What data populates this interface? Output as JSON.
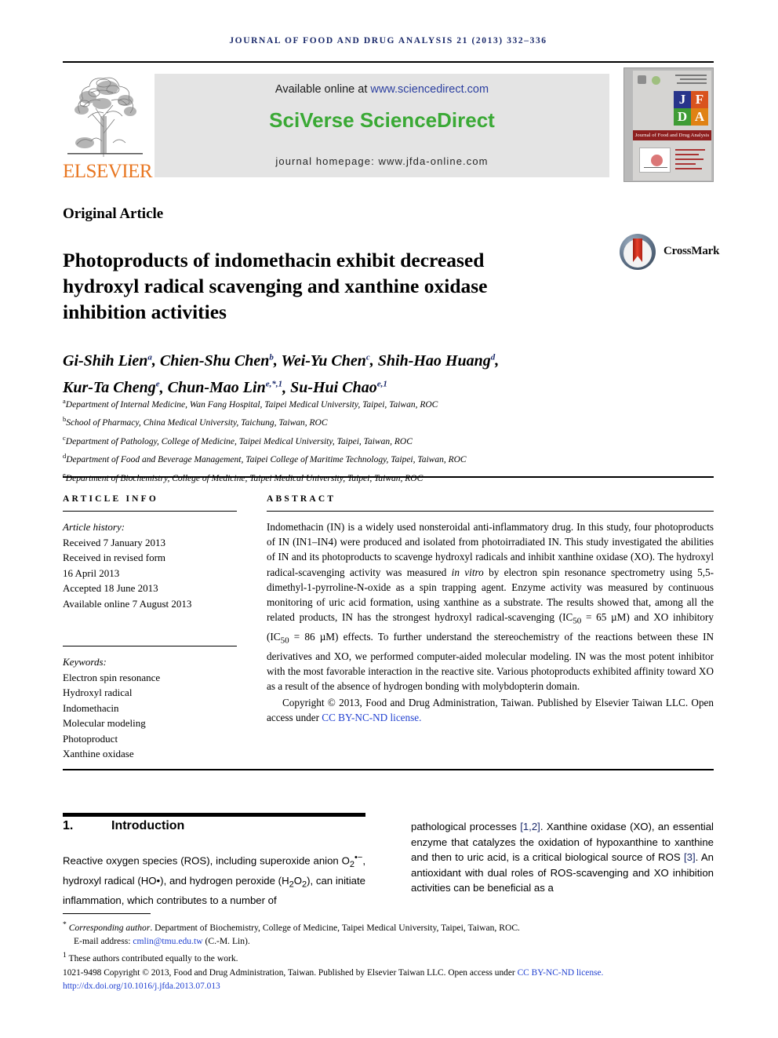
{
  "running_head": "JOURNAL OF FOOD AND DRUG ANALYSIS 21 (2013) 332–336",
  "header": {
    "publisher_name": "ELSEVIER",
    "available_prefix": "Available online at ",
    "available_url": "www.sciencedirect.com",
    "platform_title": "SciVerse ScienceDirect",
    "homepage_line": "journal homepage: www.jfda-online.com",
    "cover": {
      "tiles": [
        "J",
        "F",
        "D",
        "A"
      ],
      "strip_text": "Journal of Food and Drug Analysis",
      "tile_colors": [
        "#27348b",
        "#d9531e",
        "#3f9c35",
        "#e08214"
      ]
    }
  },
  "article": {
    "type": "Original Article",
    "title": "Photoproducts of indomethacin exhibit decreased hydroxyl radical scavenging and xanthine oxidase inhibition activities",
    "crossmark_label": "CrossMark",
    "authors_line_1": "Gi-Shih Lien a, Chien-Shu Chen b, Wei-Yu Chen c, Shih-Hao Huang d,",
    "authors_line_2": "Kur-Ta Cheng e, Chun-Mao Lin e,*,1, Su-Hui Chao e,1",
    "authors": [
      {
        "name": "Gi-Shih Lien",
        "marks": "a"
      },
      {
        "name": "Chien-Shu Chen",
        "marks": "b"
      },
      {
        "name": "Wei-Yu Chen",
        "marks": "c"
      },
      {
        "name": "Shih-Hao Huang",
        "marks": "d"
      },
      {
        "name": "Kur-Ta Cheng",
        "marks": "e"
      },
      {
        "name": "Chun-Mao Lin",
        "marks": "e,*,1"
      },
      {
        "name": "Su-Hui Chao",
        "marks": "e,1"
      }
    ],
    "affiliations": [
      {
        "mark": "a",
        "text": "Department of Internal Medicine, Wan Fang Hospital, Taipei Medical University, Taipei, Taiwan, ROC"
      },
      {
        "mark": "b",
        "text": "School of Pharmacy, China Medical University, Taichung, Taiwan, ROC"
      },
      {
        "mark": "c",
        "text": "Department of Pathology, College of Medicine, Taipei Medical University, Taipei, Taiwan, ROC"
      },
      {
        "mark": "d",
        "text": "Department of Food and Beverage Management, Taipei College of Maritime Technology, Taipei, Taiwan, ROC"
      },
      {
        "mark": "e",
        "text": "Department of Biochemistry, College of Medicine, Taipei Medical University, Taipei, Taiwan, ROC"
      }
    ]
  },
  "article_info": {
    "heading": "ARTICLE INFO",
    "history_label": "Article history:",
    "history": [
      "Received 7 January 2013",
      "Received in revised form",
      "16 April 2013",
      "Accepted 18 June 2013",
      "Available online 7 August 2013"
    ],
    "keywords_label": "Keywords:",
    "keywords": [
      "Electron spin resonance",
      "Hydroxyl radical",
      "Indomethacin",
      "Molecular modeling",
      "Photoproduct",
      "Xanthine oxidase"
    ]
  },
  "abstract": {
    "heading": "ABSTRACT",
    "text": "Indomethacin (IN) is a widely used nonsteroidal anti-inflammatory drug. In this study, four photoproducts of IN (IN1–IN4) were produced and isolated from photoirradiated IN. This study investigated the abilities of IN and its photoproducts to scavenge hydroxyl radicals and inhibit xanthine oxidase (XO). The hydroxyl radical-scavenging activity was measured in vitro by electron spin resonance spectrometry using 5,5-dimethyl-1-pyrroline-N-oxide as a spin trapping agent. Enzyme activity was measured by continuous monitoring of uric acid formation, using xanthine as a substrate. The results showed that, among all the related products, IN has the strongest hydroxyl radical-scavenging (IC50 = 65 μM) and XO inhibitory (IC50 = 86 μM) effects. To further understand the stereochemistry of the reactions between these IN derivatives and XO, we performed computer-aided molecular modeling. IN was the most potent inhibitor with the most favorable interaction in the reactive site. Various photoproducts exhibited affinity toward XO as a result of the absence of hydrogen bonding with molybdopterin domain.",
    "copyright": "Copyright © 2013, Food and Drug Administration, Taiwan. Published by Elsevier Taiwan LLC. Open access under ",
    "license_link": "CC BY-NC-ND license."
  },
  "section": {
    "number": "1.",
    "title": "Introduction",
    "left_text": "Reactive oxygen species (ROS), including superoxide anion O2•−, hydroxyl radical (HO•), and hydrogen peroxide (H2O2), can initiate inflammation, which contributes to a number of",
    "right_text": "pathological processes [1,2]. Xanthine oxidase (XO), an essential enzyme that catalyzes the oxidation of hypoxanthine to xanthine and then to uric acid, is a critical biological source of ROS [3]. An antioxidant with dual roles of ROS-scavenging and XO inhibition activities can be beneficial as a"
  },
  "footnotes": {
    "corresponding_label": "Corresponding author",
    "corresponding_text": ". Department of Biochemistry, College of Medicine, Taipei Medical University, Taipei, Taiwan, ROC.",
    "email_label": "E-mail address: ",
    "email": "cmlin@tmu.edu.tw",
    "email_suffix": " (C.-M. Lin).",
    "equal_contrib": "These authors contributed equally to the work."
  },
  "imprint": {
    "issn_copyright": "1021-9498  Copyright © 2013, Food and Drug Administration, Taiwan. Published by Elsevier Taiwan LLC. Open access under ",
    "license_link": "CC BY-NC-ND license.",
    "doi": "http://dx.doi.org/10.1016/j.jfda.2013.07.013"
  },
  "colors": {
    "running_head": "#1b2a6b",
    "link": "#1f3fd0",
    "elsevier_orange": "#E87722",
    "sciencedirect_green": "#3aa935",
    "banner_gray": "#e4e4e4"
  }
}
